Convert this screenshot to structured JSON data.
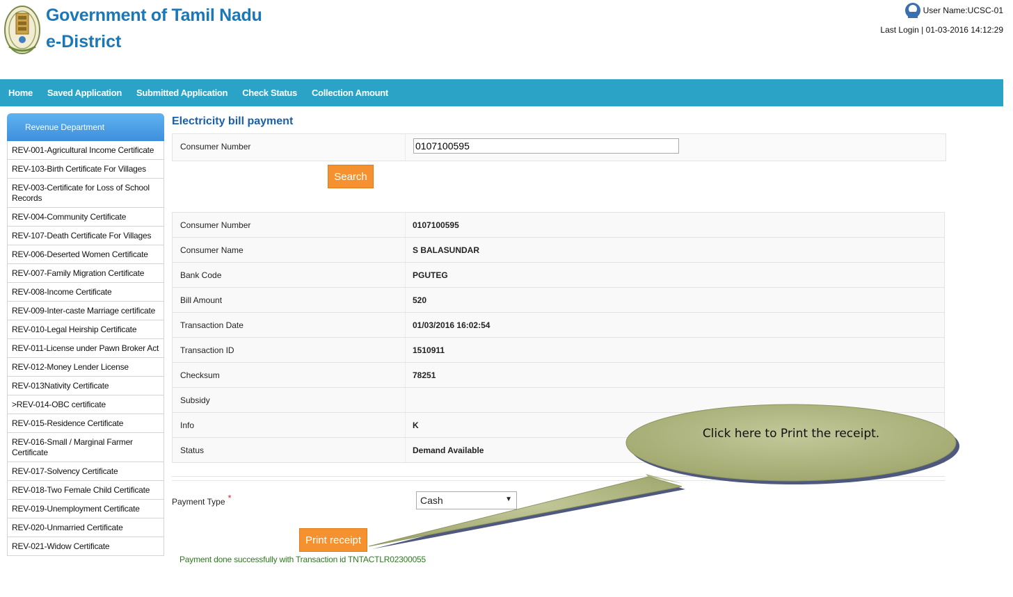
{
  "header": {
    "title": "Government of Tamil Nadu",
    "subtitle": "e-District",
    "user_name": "User Name:UCSC-01",
    "last_login": "Last Login | 01-03-2016 14:12:29"
  },
  "nav": {
    "items": [
      {
        "label": "Home"
      },
      {
        "label": "Saved Application"
      },
      {
        "label": "Submitted Application"
      },
      {
        "label": "Check Status"
      },
      {
        "label": "Collection Amount"
      }
    ]
  },
  "sidebar": {
    "heading": "Revenue Department",
    "items": [
      {
        "label": "REV-001-Agricultural Income Certificate"
      },
      {
        "label": "REV-103-Birth Certificate For Villages"
      },
      {
        "label": "REV-003-Certificate for Loss of School Records"
      },
      {
        "label": "REV-004-Community Certificate"
      },
      {
        "label": "REV-107-Death Certificate For Villages"
      },
      {
        "label": "REV-006-Deserted Women Certificate"
      },
      {
        "label": "REV-007-Family Migration Certificate"
      },
      {
        "label": "REV-008-Income Certificate"
      },
      {
        "label": "REV-009-Inter-caste Marriage certificate"
      },
      {
        "label": "REV-010-Legal Heirship Certificate"
      },
      {
        "label": "REV-011-License under Pawn Broker Act"
      },
      {
        "label": "REV-012-Money Lender License"
      },
      {
        "label": "REV-013Nativity Certificate"
      },
      {
        "label": ">REV-014-OBC certificate"
      },
      {
        "label": "REV-015-Residence Certificate"
      },
      {
        "label": "REV-016-Small / Marginal Farmer Certificate"
      },
      {
        "label": "REV-017-Solvency Certificate"
      },
      {
        "label": "REV-018-Two Female Child Certificate"
      },
      {
        "label": "REV-019-Unemployment Certificate"
      },
      {
        "label": "REV-020-Unmarried Certificate"
      },
      {
        "label": "REV-021-Widow Certificate"
      }
    ]
  },
  "main": {
    "page_title": "Electricity bill payment",
    "search_label": "Consumer Number",
    "search_value": "0107100595",
    "search_button": "Search",
    "details": [
      {
        "label": "Consumer Number",
        "value": "0107100595"
      },
      {
        "label": "Consumer Name",
        "value": "S BALASUNDAR"
      },
      {
        "label": "Bank Code",
        "value": "PGUTEG"
      },
      {
        "label": "Bill Amount",
        "value": "520"
      },
      {
        "label": "Transaction Date",
        "value": "01/03/2016 16:02:54"
      },
      {
        "label": "Transaction ID",
        "value": "1510911"
      },
      {
        "label": "Checksum",
        "value": "78251"
      },
      {
        "label": "Subsidy",
        "value": ""
      },
      {
        "label": "Info",
        "value": "K"
      },
      {
        "label": "Status",
        "value": "Demand Available"
      }
    ],
    "payment_type_label": "Payment Type",
    "required_mark": "*",
    "payment_type_value": "Cash",
    "print_button": "Print receipt",
    "success_message": "Payment done successfully with Transaction id TNTACTLR02300055"
  },
  "callout": {
    "text": "Click here to Print the receipt."
  },
  "icons": {
    "emblem": "tamil-nadu-emblem-icon",
    "user": "user-icon",
    "dropdown": "chevron-down-icon"
  },
  "colors": {
    "nav_bar": "#2aa3c7",
    "brand_text": "#1a77b8",
    "sidebar_head": "#3d8fdc",
    "button_orange": "#f5922f",
    "success_text": "#2b7a1d",
    "callout_fill": "#aab07a"
  }
}
